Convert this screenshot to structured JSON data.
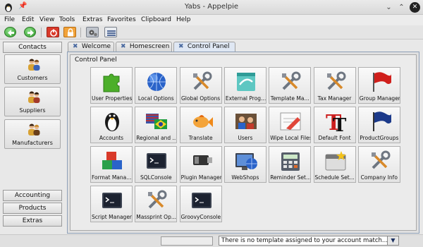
{
  "window": {
    "title": "Yabs - Appelpie"
  },
  "menu": [
    "File",
    "Edit",
    "View",
    "Tools",
    "Extras",
    "Favorites",
    "Clipboard",
    "Help"
  ],
  "toolbar": {
    "buttons": [
      "back-icon",
      "forward-icon",
      "power-icon",
      "lock-icon",
      "gears-icon",
      "list-icon"
    ]
  },
  "sidebar": {
    "contacts": "Contacts",
    "items": [
      {
        "label": "Customers",
        "icon": "customers-icon"
      },
      {
        "label": "Suppliers",
        "icon": "suppliers-icon"
      },
      {
        "label": "Manufacturers",
        "icon": "manufacturers-icon"
      }
    ],
    "sections": [
      "Accounting",
      "Products",
      "Extras"
    ]
  },
  "tabs": [
    {
      "label": "Welcome",
      "active": false
    },
    {
      "label": "Homescreen",
      "active": false
    },
    {
      "label": "Control Panel",
      "active": true
    }
  ],
  "panel": {
    "title": "Control Panel",
    "tiles": [
      {
        "label": "User Properties",
        "icon": "puzzle-icon"
      },
      {
        "label": "Local Options",
        "icon": "globe-icon"
      },
      {
        "label": "Global Options",
        "icon": "tools-icon"
      },
      {
        "label": "External Prog...",
        "icon": "document-icon"
      },
      {
        "label": "Template Ma...",
        "icon": "tools-icon"
      },
      {
        "label": "Tax Manager",
        "icon": "tools-icon"
      },
      {
        "label": "Group Manager",
        "icon": "red-flag-icon"
      },
      {
        "label": "Accounts",
        "icon": "penguin-icon"
      },
      {
        "label": "Regional and ...",
        "icon": "flags-icon"
      },
      {
        "label": "Translate",
        "icon": "fish-icon"
      },
      {
        "label": "Users",
        "icon": "users-icon"
      },
      {
        "label": "Wipe Local Files",
        "icon": "eraser-icon"
      },
      {
        "label": "Default Font",
        "icon": "font-icon"
      },
      {
        "label": "ProductGroups",
        "icon": "blue-flag-icon"
      },
      {
        "label": "Format Mana...",
        "icon": "blocks-icon"
      },
      {
        "label": "SQLConsole",
        "icon": "terminal-icon"
      },
      {
        "label": "Plugin Manager",
        "icon": "usb-icon"
      },
      {
        "label": "WebShops",
        "icon": "monitor-globe-icon"
      },
      {
        "label": "Reminder Set...",
        "icon": "calculator-icon"
      },
      {
        "label": "Schedule Set...",
        "icon": "schedule-icon"
      },
      {
        "label": "Company Info",
        "icon": "tools-icon"
      },
      {
        "label": "Script Manager",
        "icon": "terminal-icon"
      },
      {
        "label": "Massprint Op...",
        "icon": "tools-icon"
      },
      {
        "label": "GroovyConsole",
        "icon": "terminal-icon"
      }
    ]
  },
  "status": {
    "message": "There is no template assigned to your account match..."
  }
}
